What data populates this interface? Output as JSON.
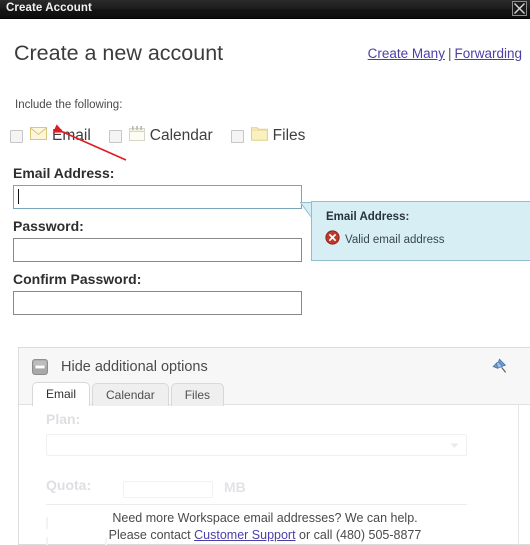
{
  "window": {
    "title": "Create Account",
    "close_icon": "close-icon"
  },
  "header": {
    "heading": "Create a new account",
    "links": [
      {
        "label": "Create Many"
      },
      {
        "label": "Forwarding"
      }
    ],
    "link_separator": "|"
  },
  "include": {
    "label": "Include the following:",
    "items": [
      {
        "label": "Email",
        "icon": "envelope-icon",
        "checked": false
      },
      {
        "label": "Calendar",
        "icon": "calendar-icon",
        "checked": false
      },
      {
        "label": "Files",
        "icon": "folder-icon",
        "checked": false
      }
    ]
  },
  "form": {
    "email": {
      "label": "Email Address:",
      "value": "",
      "placeholder": ""
    },
    "password": {
      "label": "Password:",
      "value": "",
      "placeholder": ""
    },
    "confirm_password": {
      "label": "Confirm Password:",
      "value": "",
      "placeholder": ""
    }
  },
  "tooltip": {
    "title": "Email Address:",
    "message": "Valid email address",
    "status_icon": "error-circle-icon",
    "background": "#d7eef5",
    "border": "#8fbfcf",
    "icon_color": "#c0392b"
  },
  "additional_options": {
    "toggle_label": "Hide additional options",
    "collapse_icon": "collapse-minus-icon",
    "pin_icon": "pushpin-icon",
    "tabs": [
      {
        "label": "Email",
        "active": true
      },
      {
        "label": "Calendar",
        "active": false
      },
      {
        "label": "Files",
        "active": false
      }
    ],
    "fields": {
      "plan_label": "Plan:",
      "plan_value": "",
      "quota_label": "Quota:",
      "quota_value": "",
      "quota_unit": "MB"
    }
  },
  "footer": {
    "line1": "Need more Workspace email addresses? We can help.",
    "line2_prefix": "Please contact ",
    "link": "Customer Support",
    "line2_suffix": " or call (480) 505-8877"
  },
  "annotation": {
    "arrow_color": "#e11b22",
    "points_to": "email-checkbox"
  }
}
